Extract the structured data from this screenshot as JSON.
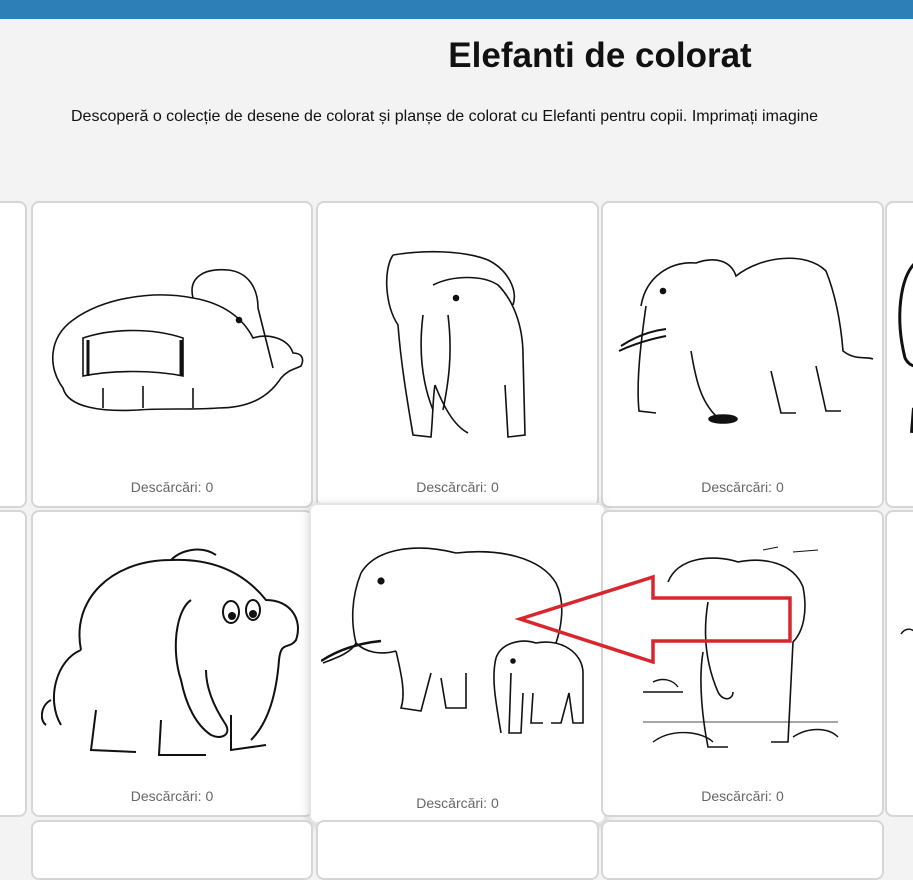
{
  "page": {
    "title": "Elefanti de colorat",
    "description": "Descoperă o colecție de desene de colorat și planșe de colorat cu Elefanti pentru copii. Imprimați imagine"
  },
  "gallery": {
    "cards": [
      {
        "subject": "elephant-with-blanket",
        "downloads": "Descărcări: 0"
      },
      {
        "subject": "elephant-front-view",
        "downloads": "Descărcări: 0"
      },
      {
        "subject": "african-elephant-side-view",
        "downloads": "Descărcări: 0"
      },
      {
        "subject": "cartoon-elephant",
        "downloads": "Descărcări: 0"
      },
      {
        "subject": "elephant-with-calf",
        "downloads": "Descărcări: 0"
      },
      {
        "subject": "elephant-in-savanna",
        "downloads": "Descărcări: 0"
      }
    ]
  },
  "annotation": {
    "arrow_color": "#d8262d"
  },
  "colors": {
    "topbar": "#2d7fb8",
    "background": "#f3f3f3",
    "card_border": "#d6d6d6",
    "caption": "#666666"
  }
}
